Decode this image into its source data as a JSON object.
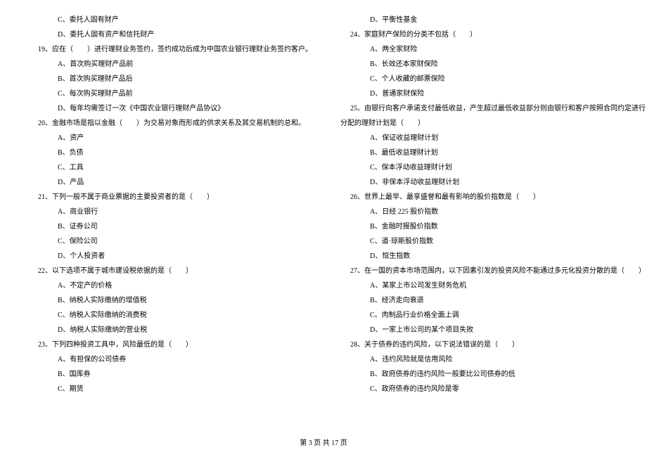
{
  "left": [
    {
      "cls": "opt",
      "t": "C、委托人固有财产"
    },
    {
      "cls": "opt",
      "t": "D、委托人固有资产和信托财产"
    },
    {
      "cls": "q",
      "t": "19、应在（　　）进行理财业务签约，签约成功后成为中国农业银行理财业务签约客户。"
    },
    {
      "cls": "opt",
      "t": "A、首次购买理财产品前"
    },
    {
      "cls": "opt",
      "t": "B、首次购买理财产品后"
    },
    {
      "cls": "opt",
      "t": "C、每次购买理财产品前"
    },
    {
      "cls": "opt",
      "t": "D、每年均需签订一次《中国农业银行理财产品协议》"
    },
    {
      "cls": "q",
      "t": "20、金融市场是指以金融（　　）为交易对象而形成的供求关系及其交易机制的总和。"
    },
    {
      "cls": "opt",
      "t": "A、资产"
    },
    {
      "cls": "opt",
      "t": "B、负债"
    },
    {
      "cls": "opt",
      "t": "C、工具"
    },
    {
      "cls": "opt",
      "t": "D、产品"
    },
    {
      "cls": "q",
      "t": "21、下列一般不属于商业票据的主要投资者的是（　　）"
    },
    {
      "cls": "opt",
      "t": "A、商业银行"
    },
    {
      "cls": "opt",
      "t": "B、证券公司"
    },
    {
      "cls": "opt",
      "t": "C、保险公司"
    },
    {
      "cls": "opt",
      "t": "D、个人投资者"
    },
    {
      "cls": "q",
      "t": "22、以下选项不属于城市建设税依据的是（　　）"
    },
    {
      "cls": "opt",
      "t": "A、不定产的价格"
    },
    {
      "cls": "opt",
      "t": "B、纳税人实际缴纳的增值税"
    },
    {
      "cls": "opt",
      "t": "C、纳税人实际缴纳的消费税"
    },
    {
      "cls": "opt",
      "t": "D、纳税人实际缴纳的营业税"
    },
    {
      "cls": "q",
      "t": "23、下列四种投资工具中，风险最低的是（　　）"
    },
    {
      "cls": "opt",
      "t": "A、有担保的公司债券"
    },
    {
      "cls": "opt",
      "t": "B、国库券"
    },
    {
      "cls": "opt",
      "t": "C、期货"
    }
  ],
  "right": [
    {
      "cls": "opt",
      "t": "D、平衡性基金"
    },
    {
      "cls": "q",
      "t": "24、家庭财产保险的分类不包括（　　）"
    },
    {
      "cls": "opt",
      "t": "A、两全家财险"
    },
    {
      "cls": "opt",
      "t": "B、长效还本家财保险"
    },
    {
      "cls": "opt",
      "t": "C、个人收藏的邮票保险"
    },
    {
      "cls": "opt",
      "t": "D、普通家财保险"
    },
    {
      "cls": "q",
      "t": "25、由银行向客户承诺支付最低收益，产生超过最低收益部分则由银行和客户按照合同约定进行"
    },
    {
      "cls": "",
      "t": "分配的理财计划是（　　）"
    },
    {
      "cls": "opt",
      "t": "A、保证收益理财计划"
    },
    {
      "cls": "opt",
      "t": "B、最低收益理财计划"
    },
    {
      "cls": "opt",
      "t": "C、保本浮动收益理财计划"
    },
    {
      "cls": "opt",
      "t": "D、非保本浮动收益理财计划"
    },
    {
      "cls": "q",
      "t": "26、世界上最早、最享盛誉和最有影响的股价指数是（　　）"
    },
    {
      "cls": "opt",
      "t": "A、日经 225 股价指数"
    },
    {
      "cls": "opt",
      "t": "B、金融时报股价指数"
    },
    {
      "cls": "opt",
      "t": "C、道·琼斯股价指数"
    },
    {
      "cls": "opt",
      "t": "D、恒生指数"
    },
    {
      "cls": "q",
      "t": "27、在一国的资本市场范围内，以下因素引发的投资风险不能通过多元化投资分散的是（　　）"
    },
    {
      "cls": "opt",
      "t": "A、某家上市公司发生财务危机"
    },
    {
      "cls": "opt",
      "t": "B、经济走向衰退"
    },
    {
      "cls": "opt",
      "t": "C、肉制品行业价格全面上调"
    },
    {
      "cls": "opt",
      "t": "D、一家上市公司的某个项目失败"
    },
    {
      "cls": "q",
      "t": "28、关于债券的违约风险，以下说法错误的是（　　）"
    },
    {
      "cls": "opt",
      "t": "A、违约风险就是信用风险"
    },
    {
      "cls": "opt",
      "t": "B、政府债券的违约风险一般要比公司债券的低"
    },
    {
      "cls": "opt",
      "t": "C、政府债券的违约风险是零"
    }
  ],
  "footer": "第 3 页 共 17 页"
}
